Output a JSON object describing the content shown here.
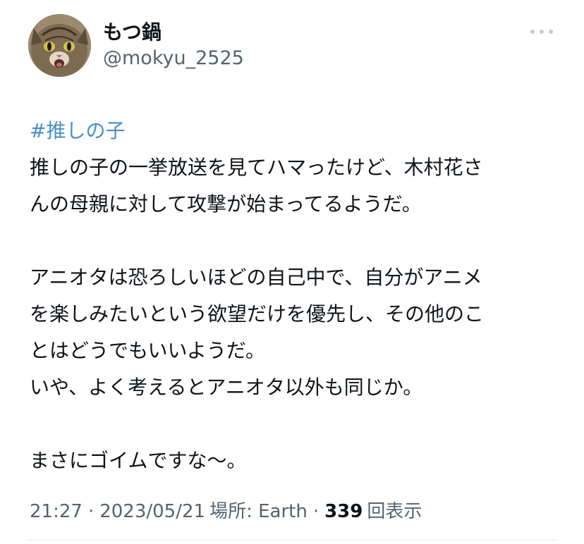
{
  "user": {
    "display_name": "もつ鍋",
    "handle": "@mokyu_2525"
  },
  "icons": {
    "avatar": "cat-photo-avatar",
    "more": "more-dots-icon"
  },
  "tweet": {
    "hashtag": "#推しの子",
    "lines": [
      "推しの子の一挙放送を見てハマったけど、木村花さ",
      "んの母親に対して攻撃が始まってるようだ。",
      "",
      "アニオタは恐ろしいほどの自己中で、自分がアニメ",
      "を楽しみたいという欲望だけを優先し、その他のこ",
      "とはどうでもいいようだ。",
      "いや、よく考えるとアニオタ以外も同じか。",
      "",
      "まさにゴイムですな〜。"
    ]
  },
  "meta": {
    "time": "21:27",
    "separator": "·",
    "date": "2023/05/21",
    "location_label": "場所: Earth",
    "views_count": "339",
    "views_label": "回表示"
  },
  "colors": {
    "hashtag": "#4a8ec9",
    "secondary_text": "#536471",
    "primary_text": "#0f1419"
  }
}
